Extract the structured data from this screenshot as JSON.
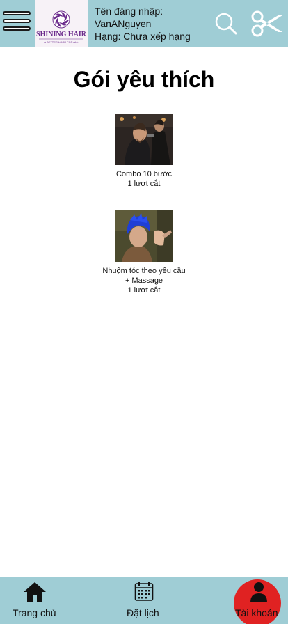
{
  "header": {
    "username_label": "Tên đăng nhập:",
    "username": "VanANguyen",
    "rank": "Hạng: Chưa xếp hạng",
    "logo_text": "SHINING HAIR",
    "logo_tagline": "A BETTER LOOK FOR ALL",
    "menu_icon": "hamburger-menu-icon",
    "search_icon": "search-icon",
    "scissors_icon": "scissors-icon"
  },
  "page": {
    "title": "Gói yêu thích"
  },
  "packages": [
    {
      "name": "Combo 10 bước",
      "count": "1 lượt cắt",
      "image": "barber-haircut-photo"
    },
    {
      "name_line1": "Nhuộm tóc theo yêu cầu",
      "name_line2": "+ Massage",
      "count": "1 lượt cắt",
      "image": "blue-hair-dye-photo"
    }
  ],
  "bottom_nav": {
    "home": "Trang chủ",
    "booking": "Đặt lịch",
    "account": "Tài khoản",
    "home_icon": "home-icon",
    "booking_icon": "calendar-icon",
    "account_icon": "user-icon",
    "active": "account"
  },
  "colors": {
    "header_bg": "#9fcdd5",
    "active_tab": "#e02222",
    "logo_purple": "#6b2a8c"
  }
}
